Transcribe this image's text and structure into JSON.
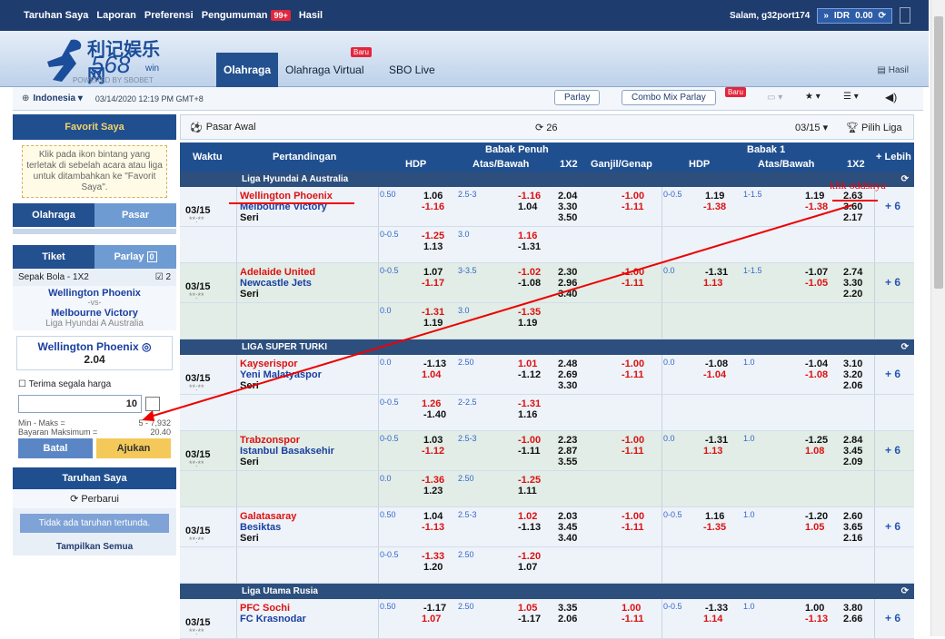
{
  "topbar": {
    "items": [
      "Taruhan Saya",
      "Laporan",
      "Preferensi",
      "Pengumuman",
      "Hasil"
    ],
    "badge": "99+",
    "greeting": "Salam, g32port174",
    "currency": "IDR",
    "balance": "0.00"
  },
  "header": {
    "logo_cn": "利记娱乐网",
    "logo_num": "568",
    "logo_win": "win",
    "logo_powered": "POWERED BY SBOBET",
    "tabs": [
      "Olahraga",
      "Olahraga Virtual",
      "SBO Live"
    ],
    "baru": "Baru",
    "hasil": "Hasil"
  },
  "subbar": {
    "country": "Indonesia",
    "datetime": "03/14/2020 12:19 PM GMT+8",
    "parlay": "Parlay",
    "combo": "Combo Mix Parlay",
    "baru": "Baru"
  },
  "left": {
    "favorit_title": "Favorit Saya",
    "favorit_text": "Klik pada ikon bintang yang terletak di sebelah acara atau liga untuk ditambahkan ke \"Favorit Saya\".",
    "tab_olahraga": "Olahraga",
    "tab_pasar": "Pasar",
    "tiket": "Tiket",
    "parlay": "Parlay",
    "parlay_count": "0",
    "sport": "Sepak Bola - 1X2",
    "check_count": "2",
    "team1": "Wellington Phoenix",
    "vs": "-vs-",
    "team2": "Melbourne Victory",
    "league": "Liga Hyundai A Australia",
    "selection": "Wellington Phoenix",
    "odds": "2.04",
    "accept": "Terima segala harga",
    "stake": "10",
    "minmax_label": "Min - Maks =",
    "minmax": "5 - 7,932",
    "maxpay_label": "Bayaran Maksimum =",
    "maxpay": "20.40",
    "batal": "Batal",
    "ajukan": "Ajukan",
    "my_bets": "Taruhan Saya",
    "refresh": "Perbarui",
    "no_bets": "Tidak ada taruhan tertunda.",
    "show_all": "Tampilkan Semua"
  },
  "main": {
    "pasar": "Pasar Awal",
    "count": "26",
    "date": "03/15",
    "pilih": "Pilih Liga",
    "h_waktu": "Waktu",
    "h_pert": "Pertandingan",
    "h_full": "Babak Penuh",
    "h_half": "Babak 1",
    "h_hdp": "HDP",
    "h_ab": "Atas/Bawah",
    "h_1x2": "1X2",
    "h_gg": "Ganjil/Genap",
    "h_lebih": "+ Lebih",
    "annotation": "klik oddsnya"
  },
  "leagues": [
    "Liga Hyundai A Australia",
    "LIGA SUPER TURKI",
    "Liga Utama Rusia"
  ],
  "matches": [
    {
      "date": "03/15",
      "time": "**:**",
      "home": "Wellington Phoenix",
      "away": "Melbourne Victory",
      "draw": "Seri",
      "hdp": "0.50",
      "hdp_h": "1.06",
      "hdp_a": "-1.16",
      "ou": "2.5-3",
      "ou_o": "-1.16",
      "ou_u": "1.04",
      "x1": "2.04",
      "x2": "3.30",
      "xd": "3.50",
      "gg_o": "-1.00",
      "gg_e": "-1.11",
      "h1hdp": "0-0.5",
      "h1h": "1.19",
      "h1a": "-1.38",
      "h1ou": "1-1.5",
      "h1o": "1.19",
      "h1u": "-1.38",
      "h1x1": "2.63",
      "h1x2": "3.60",
      "h1xd": "2.17",
      "alt_hdp": "0-0.5",
      "alt_h": "-1.25",
      "alt_a": "1.13",
      "alt_ou": "3.0",
      "alt_o": "1.16",
      "alt_u": "-1.31"
    },
    {
      "date": "03/15",
      "time": "**:**",
      "home": "Adelaide United",
      "away": "Newcastle Jets",
      "draw": "Seri",
      "hdp": "0-0.5",
      "hdp_h": "1.07",
      "hdp_a": "-1.17",
      "ou": "3-3.5",
      "ou_o": "-1.02",
      "ou_u": "-1.08",
      "x1": "2.30",
      "x2": "2.96",
      "xd": "3.40",
      "gg_o": "-1.00",
      "gg_e": "-1.11",
      "h1hdp": "0.0",
      "h1h": "-1.31",
      "h1a": "1.13",
      "h1ou": "1-1.5",
      "h1o": "-1.07",
      "h1u": "-1.05",
      "h1x1": "2.74",
      "h1x2": "3.30",
      "h1xd": "2.20",
      "alt_hdp": "0.0",
      "alt_h": "-1.31",
      "alt_a": "1.19",
      "alt_ou": "3.0",
      "alt_o": "-1.35",
      "alt_u": "1.19"
    },
    {
      "date": "03/15",
      "time": "**:**",
      "home": "Kayserispor",
      "away": "Yeni Malatyaspor",
      "draw": "Seri",
      "hdp": "0.0",
      "hdp_h": "-1.13",
      "hdp_a": "1.04",
      "ou": "2.50",
      "ou_o": "1.01",
      "ou_u": "-1.12",
      "x1": "2.48",
      "x2": "2.69",
      "xd": "3.30",
      "gg_o": "-1.00",
      "gg_e": "-1.11",
      "h1hdp": "0.0",
      "h1h": "-1.08",
      "h1a": "-1.04",
      "h1ou": "1.0",
      "h1o": "-1.04",
      "h1u": "-1.08",
      "h1x1": "3.10",
      "h1x2": "3.20",
      "h1xd": "2.06",
      "alt_hdp": "0-0.5",
      "alt_h": "1.26",
      "alt_a": "-1.40",
      "alt_ou": "2-2.5",
      "alt_o": "-1.31",
      "alt_u": "1.16"
    },
    {
      "date": "03/15",
      "time": "**:**",
      "home": "Trabzonspor",
      "away": "Istanbul Basaksehir",
      "draw": "Seri",
      "hdp": "0-0.5",
      "hdp_h": "1.03",
      "hdp_a": "-1.12",
      "ou": "2.5-3",
      "ou_o": "-1.00",
      "ou_u": "-1.11",
      "x1": "2.23",
      "x2": "2.87",
      "xd": "3.55",
      "gg_o": "-1.00",
      "gg_e": "-1.11",
      "h1hdp": "0.0",
      "h1h": "-1.31",
      "h1a": "1.13",
      "h1ou": "1.0",
      "h1o": "-1.25",
      "h1u": "1.08",
      "h1x1": "2.84",
      "h1x2": "3.45",
      "h1xd": "2.09",
      "alt_hdp": "0.0",
      "alt_h": "-1.36",
      "alt_a": "1.23",
      "alt_ou": "2.50",
      "alt_o": "-1.25",
      "alt_u": "1.11"
    },
    {
      "date": "03/15",
      "time": "**:**",
      "home": "Galatasaray",
      "away": "Besiktas",
      "draw": "Seri",
      "hdp": "0.50",
      "hdp_h": "1.04",
      "hdp_a": "-1.13",
      "ou": "2.5-3",
      "ou_o": "1.02",
      "ou_u": "-1.13",
      "x1": "2.03",
      "x2": "3.45",
      "xd": "3.40",
      "gg_o": "-1.00",
      "gg_e": "-1.11",
      "h1hdp": "0-0.5",
      "h1h": "1.16",
      "h1a": "-1.35",
      "h1ou": "1.0",
      "h1o": "-1.20",
      "h1u": "1.05",
      "h1x1": "2.60",
      "h1x2": "3.65",
      "h1xd": "2.16",
      "alt_hdp": "0-0.5",
      "alt_h": "-1.33",
      "alt_a": "1.20",
      "alt_ou": "2.50",
      "alt_o": "-1.20",
      "alt_u": "1.07"
    },
    {
      "date": "03/15",
      "time": "**:**",
      "home": "PFC Sochi",
      "away": "FC Krasnodar",
      "hdp": "0.50",
      "hdp_h": "-1.17",
      "hdp_a": "1.07",
      "ou": "2.50",
      "ou_o": "1.05",
      "ou_u": "-1.17",
      "x1": "3.35",
      "x2": "2.06",
      "gg_o": "1.00",
      "gg_e": "-1.11",
      "h1hdp": "0-0.5",
      "h1h": "-1.33",
      "h1a": "1.14",
      "h1ou": "1.0",
      "h1o": "1.00",
      "h1u": "-1.13",
      "h1x1": "3.80",
      "h1x2": "2.66"
    }
  ],
  "more": "+ 6"
}
